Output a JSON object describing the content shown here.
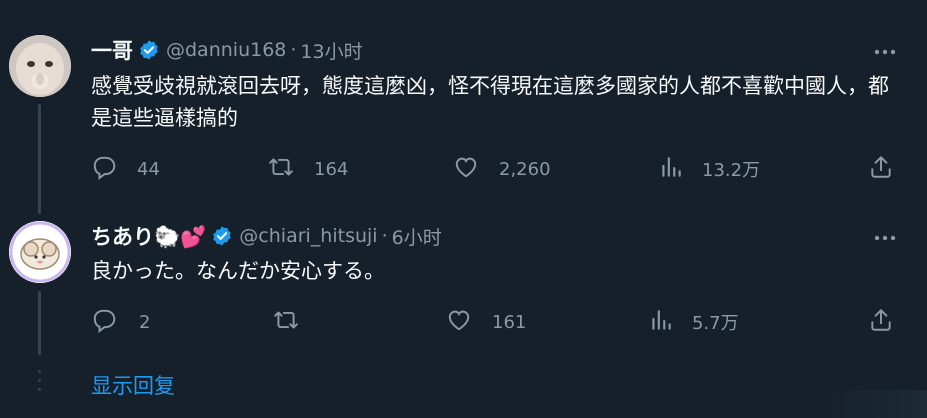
{
  "tweets": [
    {
      "display_name": "一哥",
      "handle": "@danniu168",
      "separator": "·",
      "time": "13小时",
      "text": "感覺受歧視就滾回去呀，態度這麼凶，怪不得現在這麼多國家的人都不喜歡中國人，都是這些逼樣搞的",
      "replies": "44",
      "retweets": "164",
      "likes": "2,260",
      "views": "13.2万",
      "verified_color": "#1d9bf0"
    },
    {
      "display_name": "ちあり🐑💕",
      "handle": "@chiari_hitsuji",
      "separator": "·",
      "time": "6小时",
      "text": "良かった。なんだか安心する。",
      "replies": "2",
      "retweets": "",
      "likes": "161",
      "views": "5.7万",
      "verified_color": "#1d9bf0"
    }
  ],
  "show_replies": "显示回复",
  "icons": {
    "reply": "reply-icon",
    "retweet": "retweet-icon",
    "like": "like-icon",
    "views": "views-icon",
    "share": "share-icon",
    "more": "more-icon",
    "verified": "verified-icon"
  },
  "colors": {
    "background": "#15202b",
    "text": "#f7f9f9",
    "muted": "#8b98a5",
    "accent": "#1d9bf0"
  }
}
